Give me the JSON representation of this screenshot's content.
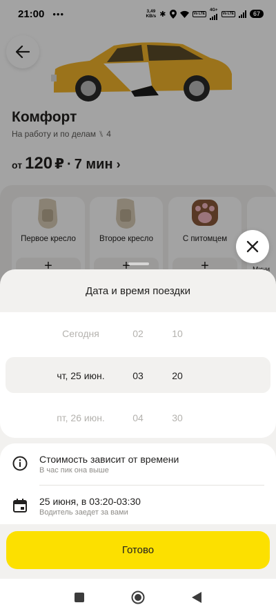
{
  "status_bar": {
    "time": "21:00",
    "dots": "•••",
    "speed_value": "3,49",
    "speed_unit": "KB/s",
    "net_label": "4G+",
    "volte_1": "Vo LTE",
    "volte_2": "Vo LTE",
    "battery": "67"
  },
  "background_screen": {
    "tariff_title": "Комфорт",
    "tariff_subtitle": "На работу и по делам",
    "seats": "4",
    "price_from": "от",
    "price_value": "120",
    "price_currency": "₽",
    "price_separator": "·",
    "eta": "7 мин",
    "options": [
      {
        "label": "Первое кресло",
        "icon": "child-seat-icon"
      },
      {
        "label": "Второе кресло",
        "icon": "child-seat-icon"
      },
      {
        "label": "С питомцем",
        "icon": "paw-icon"
      },
      {
        "label": "Мини",
        "icon": "more-icon"
      }
    ]
  },
  "sheet": {
    "title": "Дата и время поездки",
    "picker": {
      "dates": [
        "Сегодня",
        "чт, 25 июн.",
        "пт, 26 июн."
      ],
      "hours": [
        "02",
        "03",
        "04"
      ],
      "minutes": [
        "10",
        "20",
        "30"
      ],
      "selected_index": 1
    },
    "info": {
      "price_title": "Стоимость зависит от времени",
      "price_sub": "В час пик она выше",
      "date_title": "25 июня, в 03:20-03:30",
      "date_sub": "Водитель заедет за вами"
    },
    "done_label": "Готово"
  },
  "colors": {
    "accent_yellow": "#fce000",
    "sheet_bg": "#f2f1ef",
    "text_primary": "#21201f",
    "text_secondary": "#8e8c88"
  }
}
